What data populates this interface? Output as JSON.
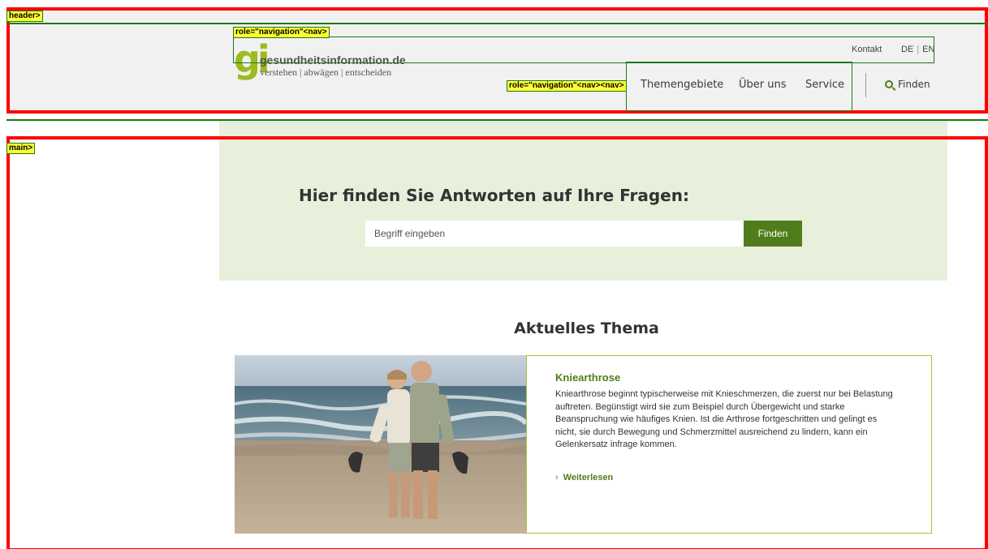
{
  "annotations": {
    "header_tag": "header>",
    "main_tag": "main>",
    "nav_tag_1": "role=\"navigation\"<nav>",
    "nav_tag_2": "role=\"navigation\"<nav><nav>"
  },
  "header": {
    "logo": {
      "mark": "gi",
      "name": "gesundheitsinformation.de",
      "tagline": "verstehen | abwägen | entscheiden"
    },
    "meta_nav": {
      "contact": "Kontakt",
      "lang_de": "DE",
      "lang_en": "EN"
    },
    "main_nav": [
      {
        "label": "Themengebiete"
      },
      {
        "label": "Über uns"
      },
      {
        "label": "Service"
      }
    ],
    "search_link": {
      "label": "Finden",
      "icon": "search-icon"
    }
  },
  "hero": {
    "title": "Hier finden Sie Antworten auf Ihre Fragen:",
    "search_placeholder": "Begriff eingeben",
    "search_button": "Finden"
  },
  "current_topic": {
    "heading": "Aktuelles Thema",
    "card": {
      "title": "Kniearthrose",
      "text": "Kniearthrose beginnt typischerweise mit Knieschmerzen, die zuerst nur bei Belastung auftreten. Begünstigt wird sie zum Beispiel durch Übergewicht und starke Beanspruchung wie häufiges Knien. Ist die Arthrose fortgeschritten und gelingt es nicht, sie durch Bewegung und Schmerzmittel ausreichend zu lindern, kann ein Gelenkersatz infrage kommen.",
      "link": "Weiterlesen",
      "image_icon": "couple-on-beach-photo"
    }
  },
  "colors": {
    "brand_green": "#4f7d1c",
    "logo_green": "#9dbb1f",
    "hero_bg": "#e8efdb",
    "annotation_red": "#ff0000",
    "annotation_tag": "#ffff33"
  }
}
